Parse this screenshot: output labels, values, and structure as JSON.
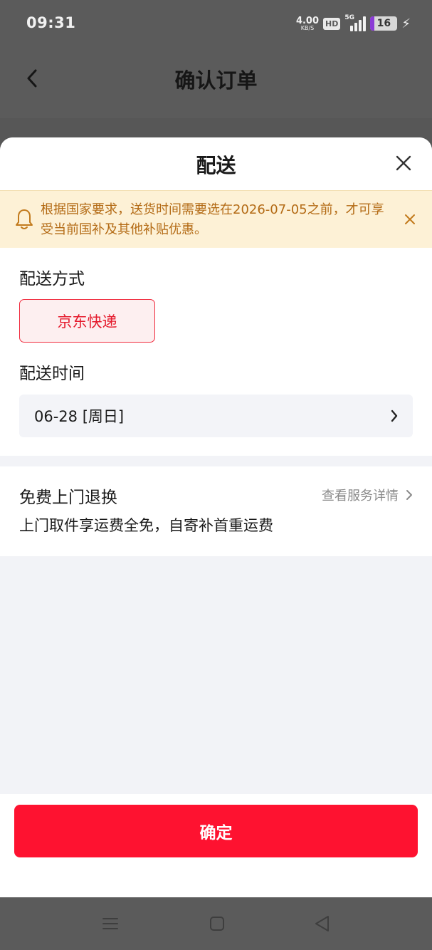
{
  "status_bar": {
    "time": "09:31",
    "net_speed": "4.00",
    "net_unit": "KB/S",
    "hd": "HD",
    "network": "5G",
    "battery": "16",
    "battery_fill": 0.16
  },
  "page": {
    "title": "确认订单"
  },
  "sheet": {
    "title": "配送",
    "notice": "根据国家要求，送货时间需要选在2026-07-05之前，才可享受当前国补及其他补贴优惠。",
    "delivery_method_label": "配送方式",
    "delivery_method_option": "京东快递",
    "delivery_time_label": "配送时间",
    "delivery_time_value": "06-28 [周日]",
    "return_title": "免费上门退换",
    "return_link": "查看服务详情",
    "return_desc": "上门取件享运费全免，自寄补首重运费",
    "confirm_label": "确定"
  },
  "colors": {
    "accent_red": "#fe1230",
    "notice_bg": "#fdf1d6",
    "notice_text": "#b36a14"
  },
  "icons": [
    "back-arrow-icon",
    "close-icon",
    "bell-icon",
    "chevron-right-icon",
    "menu-icon",
    "home-square-icon",
    "back-triangle-icon"
  ]
}
